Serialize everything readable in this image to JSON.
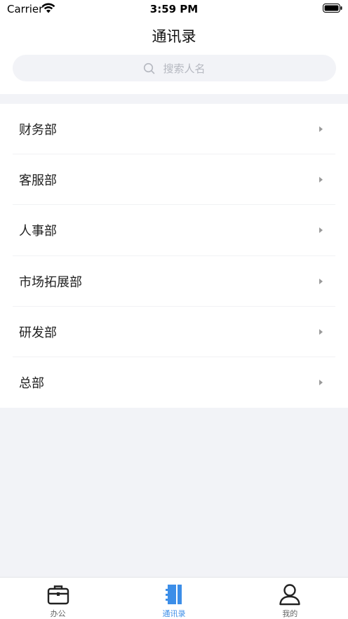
{
  "status_bar": {
    "carrier": "Carrier",
    "time": "3:59 PM"
  },
  "header": {
    "title": "通讯录"
  },
  "search": {
    "placeholder": "搜索人名",
    "icon": "search-icon"
  },
  "departments": [
    {
      "label": "财务部"
    },
    {
      "label": "客服部"
    },
    {
      "label": "人事部"
    },
    {
      "label": "市场拓展部"
    },
    {
      "label": "研发部"
    },
    {
      "label": "总部"
    }
  ],
  "tabbar": {
    "tabs": [
      {
        "label": "办公",
        "icon": "briefcase-icon",
        "active": false
      },
      {
        "label": "通讯录",
        "icon": "contacts-book-icon",
        "active": true
      },
      {
        "label": "我的",
        "icon": "person-icon",
        "active": false
      }
    ]
  },
  "colors": {
    "accent": "#3c8ee8",
    "background": "#f2f3f7",
    "text": "#222222",
    "placeholder": "#b5b8c0"
  }
}
